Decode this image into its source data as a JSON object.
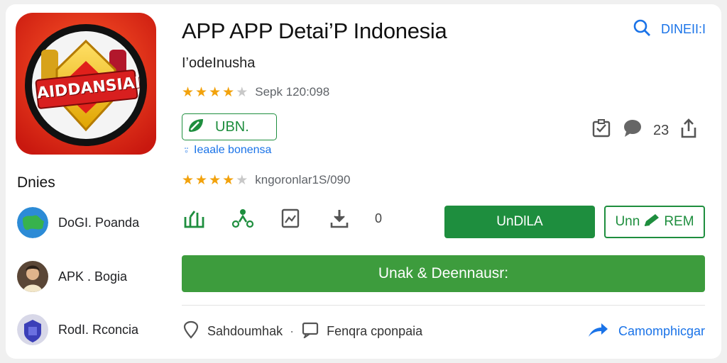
{
  "app": {
    "title": "APP APP Detai’P Indonesia",
    "developer": "I’odeInusha",
    "icon_text": "AIDDANSIAI",
    "rating_stars": 4,
    "rating_text": "Sepk 120:098",
    "badge_label": "UBN.",
    "region_text": "Ieaale bonensa",
    "rating2_stars": 4,
    "rating2_text": "kngoronlar1S/090"
  },
  "header": {
    "search_label": "DINEII:I",
    "action_count": "23"
  },
  "sidebar": {
    "title": "Dnies",
    "items": [
      {
        "label": "DoGI. Poanda",
        "icon": "globe-avatar"
      },
      {
        "label": "APK . Bogia",
        "icon": "person-avatar"
      },
      {
        "label": "RodI. Rconcia",
        "icon": "shield-avatar"
      }
    ]
  },
  "metrics": {
    "count": "0"
  },
  "buttons": {
    "install": "UnDlLA",
    "outline_left": "Unn",
    "outline_right": "REM",
    "wide": "Unak & Deennausr:"
  },
  "footer": {
    "link1": "Sahdoumhak",
    "separator": "·",
    "link2": "Fenqra cponpaia",
    "share": "Camomphicgar"
  },
  "colors": {
    "accent_green": "#1e8e3e",
    "accent_blue": "#1a73e8",
    "star": "#f2a20c"
  }
}
